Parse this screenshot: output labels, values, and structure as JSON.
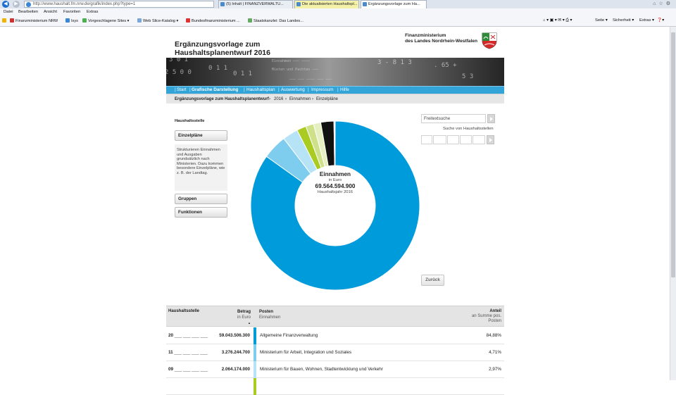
{
  "browser": {
    "address": "http://www.haushalt.fm.nrw.de/grafik/index.php?type=1",
    "tabs": [
      "(5) Inhalt | FINANZVERWALTU...",
      "Die aktualisierten Haushaltspl...",
      "Ergänzungsvorlage zum Ha..."
    ],
    "menu": [
      "Datei",
      "Bearbeiten",
      "Ansicht",
      "Favoriten",
      "Extras"
    ],
    "favorites": [
      "Finanzministerium NRW",
      "Isys",
      "Vorgeschlagene Sites ▾",
      "Web Slice-Katalog ▾",
      "Bundesfinanzministerium ...",
      "Staatskanzlei: Das Landes..."
    ],
    "tools": [
      "Seite ▾",
      "Sicherheit ▾",
      "Extras ▾"
    ],
    "accent": "#1c6fd1"
  },
  "header": {
    "title_line1": "Ergänzungsvorlage zum",
    "title_line2": "Haushaltsplanentwurf 2016",
    "ministry_line1": "Finanzministerium",
    "ministry_line2": "des Landes Nordrhein-Westfalen",
    "crest_icon": "nrw-coat-of-arms-icon"
  },
  "nav": {
    "items": [
      "Start",
      "Grafische Darstellung",
      "Haushaltsplan",
      "Auswertung",
      "Impressum",
      "Hilfe"
    ],
    "active": "Grafische Darstellung",
    "color": "#33a4d8"
  },
  "breadcrumb": [
    "Ergänzungsvorlage zum Haushaltsplanentwurf",
    "2016",
    "Einnahmen",
    "Einzelpläne"
  ],
  "sidebar": {
    "heading": "Haushaltsstelle",
    "buttons": [
      "Einzelpläne",
      "Gruppen",
      "Funktionen"
    ],
    "description": "Strukturieren Einnahmen und Ausgaben grundsätzlich nach Ministerien. Dazu kommen besondere Einzelpläne, wie z. B. der Landtag."
  },
  "donut": {
    "title": "Einnahmen",
    "unit": "in Euro",
    "total": "69.564.594.900",
    "year": "Haushaltsjahr 2016",
    "slices": [
      {
        "share": 84.88,
        "color": "#009bdb"
      },
      {
        "share": 4.71,
        "color": "#7fcdee"
      },
      {
        "share": 2.97,
        "color": "#b6e4f6"
      },
      {
        "share": 1.8,
        "color": "#aacc22"
      },
      {
        "share": 1.5,
        "color": "#cfe08a"
      },
      {
        "share": 1.4,
        "color": "#e6efc2"
      },
      {
        "share": 2.5,
        "color": "#111111"
      },
      {
        "share": 0.24,
        "color": "#ffffff"
      }
    ]
  },
  "search": {
    "placeholder": "Freitextsuche",
    "label": "Suche von Haushaltsstellen"
  },
  "back_label": "Zurück",
  "table": {
    "col_stelle": "Haushaltsstelle",
    "col_betrag": "Betrag",
    "col_betrag_sub": "in Euro",
    "col_posten": "Posten",
    "col_posten_sub": "Einnahmen",
    "col_anteil": "Anteil",
    "col_anteil_sub1": "an Summe pos.",
    "col_anteil_sub2": "Posten",
    "sort_icon": "sort-ascending-icon",
    "rows": [
      {
        "code": "20",
        "amount": "59.043.506.300",
        "label": "Allgemeine Finanzverwaltung",
        "share": "84,88%",
        "color": "#009bdb"
      },
      {
        "code": "11",
        "amount": "3.276.244.700",
        "label": "Ministerium für Arbeit, Integration und Soziales",
        "share": "4,71%",
        "color": "#7fcdee"
      },
      {
        "code": "09",
        "amount": "2.064.174.000",
        "label": "Ministerium für Bauen, Wohnen, Stadtentwicklung und Verkehr",
        "share": "2,97%",
        "color": "#b6e4f6"
      }
    ],
    "partial_row_color": "#aacc22"
  }
}
